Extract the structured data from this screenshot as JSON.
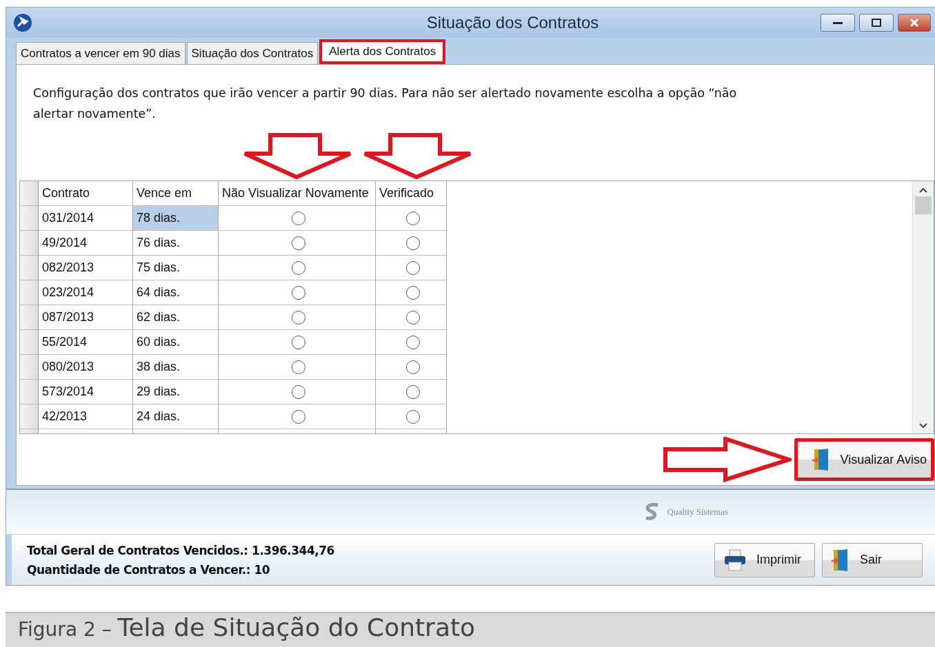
{
  "window": {
    "title": "Situação dos Contratos"
  },
  "tabs": [
    {
      "label": "Contratos a vencer  em 90 dias",
      "selected": false,
      "highlighted": false
    },
    {
      "label": "Situação dos Contratos",
      "selected": false,
      "highlighted": false
    },
    {
      "label": "Alerta dos Contratos",
      "selected": true,
      "highlighted": true
    }
  ],
  "description": "Configuração dos contratos que irão vencer a partir 90 dias. Para não ser alertado novamente escolha a opção “não alertar novamente”.",
  "table": {
    "columns": [
      "Contrato",
      "Vence em",
      "Não Visualizar Novamente",
      "Verificado"
    ],
    "rows": [
      {
        "contrato": "031/2014",
        "vence": "78 dias.",
        "nao_visualizar": false,
        "verificado": false,
        "selected": true
      },
      {
        "contrato": "49/2014",
        "vence": "76 dias.",
        "nao_visualizar": false,
        "verificado": false,
        "selected": false
      },
      {
        "contrato": "082/2013",
        "vence": "75 dias.",
        "nao_visualizar": false,
        "verificado": false,
        "selected": false
      },
      {
        "contrato": "023/2014",
        "vence": "64 dias.",
        "nao_visualizar": false,
        "verificado": false,
        "selected": false
      },
      {
        "contrato": "087/2013",
        "vence": "62 dias.",
        "nao_visualizar": false,
        "verificado": false,
        "selected": false
      },
      {
        "contrato": "55/2014",
        "vence": "60 dias.",
        "nao_visualizar": false,
        "verificado": false,
        "selected": false
      },
      {
        "contrato": "080/2013",
        "vence": "38 dias.",
        "nao_visualizar": false,
        "verificado": false,
        "selected": false
      },
      {
        "contrato": "573/2014",
        "vence": "29 dias.",
        "nao_visualizar": false,
        "verificado": false,
        "selected": false
      },
      {
        "contrato": "42/2013",
        "vence": "24 dias.",
        "nao_visualizar": false,
        "verificado": false,
        "selected": false
      }
    ]
  },
  "view_button": {
    "label": "Visualizar Aviso",
    "highlighted": true
  },
  "brand": "Quality Sistemas",
  "totals": [
    "Total Geral de Contratos Vencidos.: 1.396.344,76",
    "Quantidade de Contratos a Vencer.: 10"
  ],
  "buttons": [
    {
      "kind": "print",
      "label": "Imprimir"
    },
    {
      "kind": "exit",
      "label": "Sair"
    }
  ],
  "caption": {
    "prefix": "Figura 2 – ",
    "title": "Tela de Situação do Contrato"
  }
}
